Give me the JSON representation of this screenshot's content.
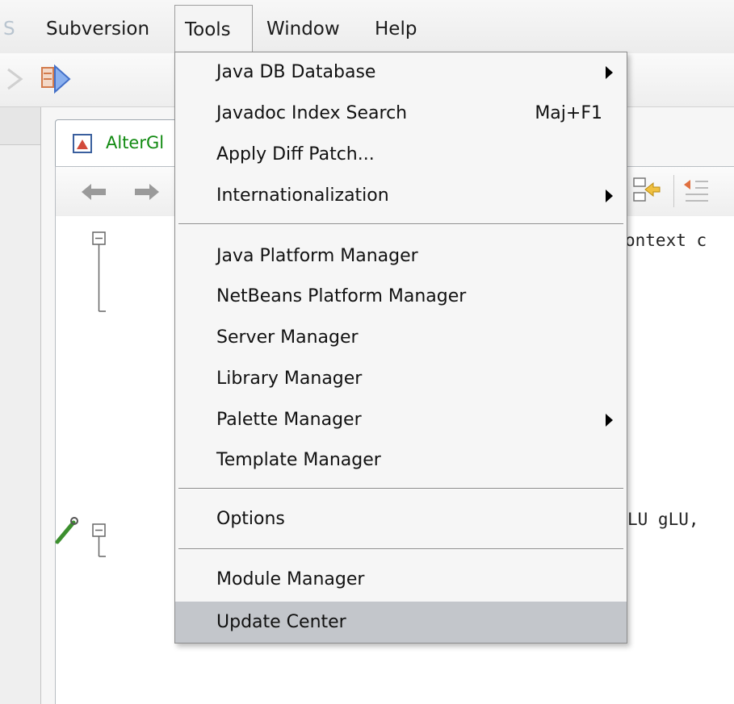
{
  "menubar": {
    "items": [
      {
        "label": "S",
        "state": "faded"
      },
      {
        "label": "Subversion",
        "state": "normal"
      },
      {
        "label": "Tools",
        "state": "open"
      },
      {
        "label": "Window",
        "state": "normal"
      },
      {
        "label": "Help",
        "state": "normal"
      }
    ]
  },
  "editor": {
    "tab_label": "AlterGl",
    "code_lines": [
      "ontext c",
      "LU gLU,"
    ]
  },
  "tools_menu": {
    "items": [
      {
        "label": "Java DB Database",
        "shortcut": "",
        "submenu": true
      },
      {
        "label": "Javadoc Index Search",
        "shortcut": "Maj+F1",
        "submenu": false
      },
      {
        "label": "Apply Diff Patch...",
        "shortcut": "",
        "submenu": false
      },
      {
        "label": "Internationalization",
        "shortcut": "",
        "submenu": true
      },
      {
        "label": "Java Platform Manager",
        "shortcut": "",
        "submenu": false
      },
      {
        "label": "NetBeans Platform Manager",
        "shortcut": "",
        "submenu": false
      },
      {
        "label": "Server Manager",
        "shortcut": "",
        "submenu": false
      },
      {
        "label": "Library Manager",
        "shortcut": "",
        "submenu": false
      },
      {
        "label": "Palette Manager",
        "shortcut": "",
        "submenu": true
      },
      {
        "label": "Template Manager",
        "shortcut": "",
        "submenu": false
      },
      {
        "label": "Options",
        "shortcut": "",
        "submenu": false
      },
      {
        "label": "Module Manager",
        "shortcut": "",
        "submenu": false
      },
      {
        "label": "Update Center",
        "shortcut": "",
        "submenu": false,
        "highlighted": true
      }
    ]
  },
  "colors": {
    "menu_background": "#f6f6f6",
    "highlight": "#c3c6cb",
    "tab_text": "#118a11"
  }
}
